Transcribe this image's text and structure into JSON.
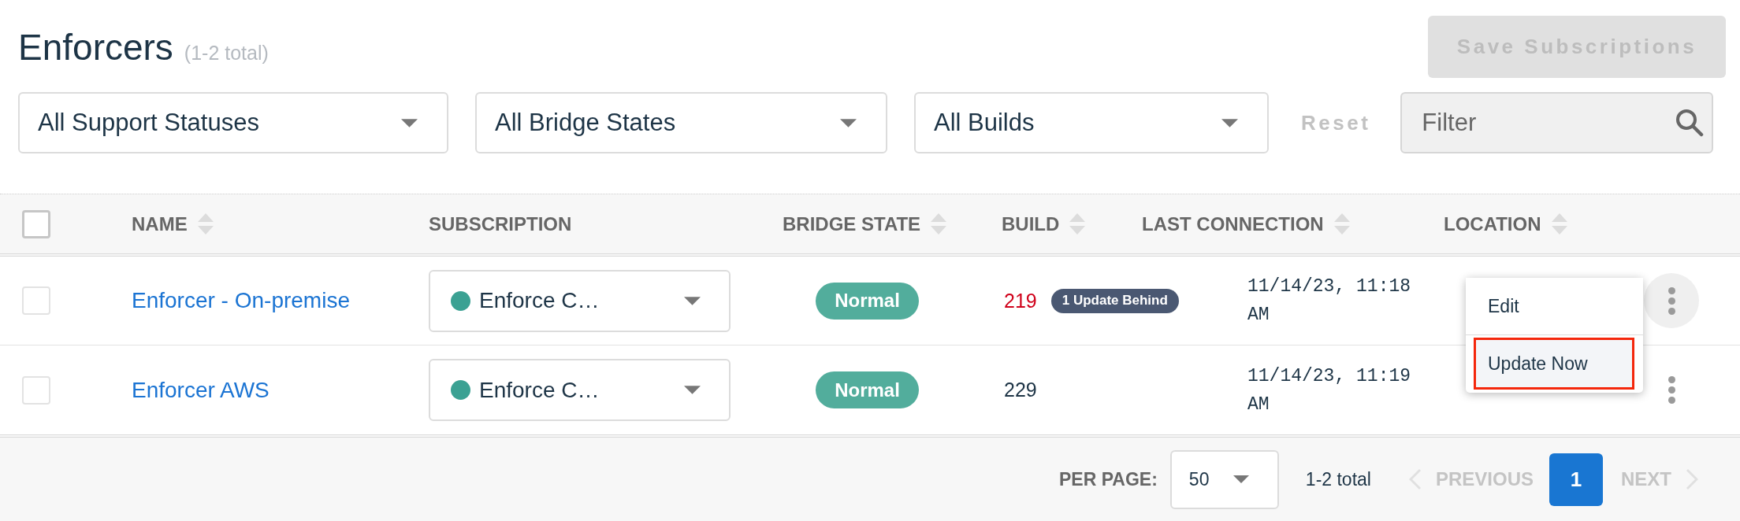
{
  "header": {
    "title": "Enforcers",
    "count": "(1-2 total)",
    "save_button": {
      "label": "Save Subscriptions",
      "disabled": true
    }
  },
  "filters": {
    "dropdowns": [
      {
        "value": "All Support Statuses"
      },
      {
        "value": "All Bridge States"
      },
      {
        "value": "All Builds"
      }
    ],
    "reset": {
      "label": "Reset",
      "disabled": true
    },
    "search": {
      "placeholder": "Filter"
    }
  },
  "table": {
    "select_all": {
      "checked": false
    },
    "columns": [
      {
        "label": "NAME",
        "sortable": true
      },
      {
        "label": "SUBSCRIPTION",
        "sortable": false
      },
      {
        "label": "BRIDGE STATE",
        "sortable": true
      },
      {
        "label": "BUILD",
        "sortable": true
      },
      {
        "label": "LAST CONNECTION",
        "sortable": true
      },
      {
        "label": "LOCATION",
        "sortable": true
      }
    ],
    "rows": [
      {
        "checked": false,
        "name": "Enforcer - On-premise",
        "subscription": {
          "value": "Enforce C…",
          "color": "#3ba193"
        },
        "bridge_state": "Normal",
        "build": "219",
        "outdated": true,
        "update_badge": "1 Update Behind",
        "last_connection": "11/14/23, 11:18 AM",
        "menu_open": true
      },
      {
        "checked": false,
        "name": "Enforcer AWS",
        "subscription": {
          "value": "Enforce C…",
          "color": "#3ba193"
        },
        "bridge_state": "Normal",
        "build": "229",
        "outdated": false,
        "last_connection": "11/14/23, 11:19 AM",
        "menu_open": false
      }
    ]
  },
  "row_menu": {
    "items": [
      {
        "label": "Edit",
        "highlighted": false
      },
      {
        "label": "Update Now",
        "highlighted": true
      }
    ]
  },
  "pagination": {
    "per_page_label": "PER PAGE:",
    "per_page": "50",
    "total": "1-2 total",
    "previous": {
      "label": "PREVIOUS",
      "disabled": true
    },
    "pages": [
      {
        "label": "1",
        "selected": true
      }
    ],
    "next": {
      "label": "NEXT",
      "disabled": true
    }
  }
}
